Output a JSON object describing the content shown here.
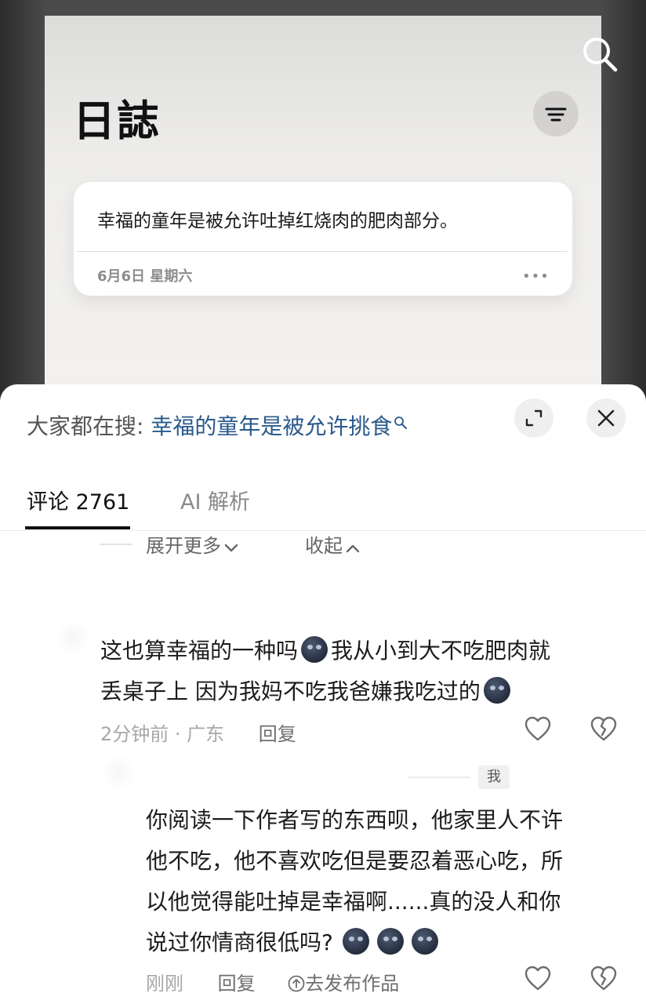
{
  "journal": {
    "title": "日誌",
    "entry": {
      "text": "幸福的童年是被允许吐掉红烧肉的肥肉部分。",
      "date": "6月6日 星期六",
      "more": "•••"
    }
  },
  "sheet": {
    "search_prefix": "大家都在搜",
    "search_sep": ":",
    "search_term": "幸福的童年是被允许挑食",
    "tabs": [
      {
        "label": "评论 2761",
        "active": true
      },
      {
        "label": "AI 解析",
        "active": false
      }
    ],
    "expand_more": "展开更多",
    "collapse": "收起"
  },
  "comments": [
    {
      "line1": "这也算幸福的一种吗",
      "line1b": "我从小到大不吃肥肉就",
      "line2": "丢桌子上 因为我妈不吃我爸嫌我吃过的",
      "time": "2分钟前 · 广东",
      "reply": "回复"
    },
    {
      "author_badge": "我",
      "line1": "你阅读一下作者写的东西呗，他家里人不许",
      "line2": "他不吃，他不喜欢吃但是要忍着恶心吃，所",
      "line3": "以他觉得能吐掉是幸福啊......真的没人和你",
      "line4": "说过你情商很低吗?",
      "time": "刚刚",
      "reply": "回复",
      "publish": "去发布作品"
    }
  ],
  "colors": {
    "accent_link": "#2a5a8c",
    "muted": "#a8a8a8",
    "emoji_icon": "new-moon-face-icon"
  }
}
